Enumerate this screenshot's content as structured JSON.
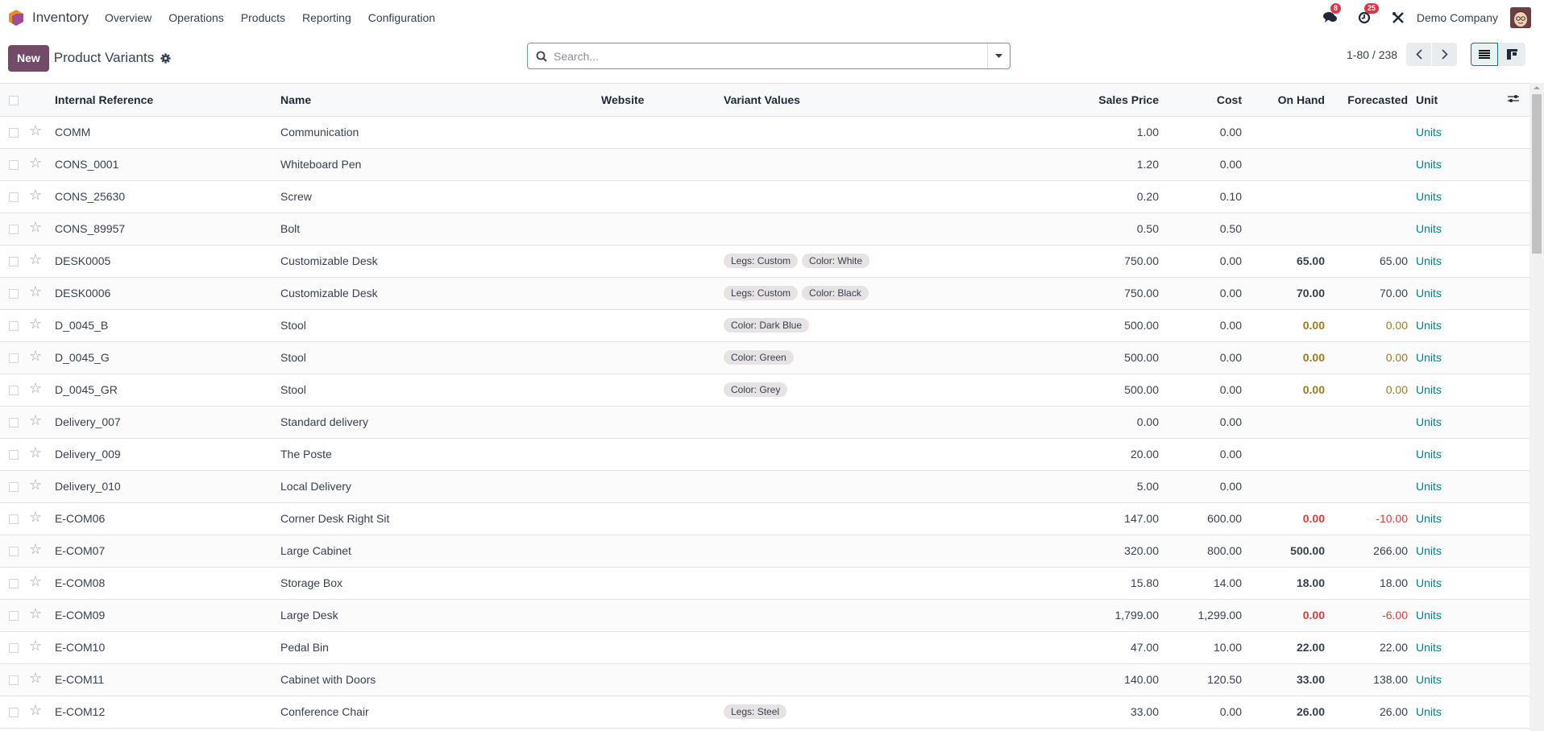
{
  "navbar": {
    "app_name": "Inventory",
    "menu": [
      "Overview",
      "Operations",
      "Products",
      "Reporting",
      "Configuration"
    ],
    "messages_badge": "8",
    "activities_badge": "25",
    "company": "Demo Company"
  },
  "control": {
    "new_label": "New",
    "title": "Product Variants",
    "search_placeholder": "Search...",
    "pager": "1-80 / 238"
  },
  "colors": {
    "brand": "#714B67",
    "link": "#017e84",
    "warning": "#9b7a21",
    "danger": "#d23f3a",
    "badge": "#dc3545"
  },
  "table": {
    "columns": {
      "ref": "Internal Reference",
      "name": "Name",
      "website": "Website",
      "variants": "Variant Values",
      "price": "Sales Price",
      "cost": "Cost",
      "onhand": "On Hand",
      "forecast": "Forecasted",
      "unit": "Unit"
    },
    "rows": [
      {
        "ref": "COMM",
        "name": "Communication",
        "variants": [],
        "price": "1.00",
        "cost": "0.00",
        "onhand": "",
        "forecast": "",
        "unit": "Units",
        "state": ""
      },
      {
        "ref": "CONS_0001",
        "name": "Whiteboard Pen",
        "variants": [],
        "price": "1.20",
        "cost": "0.00",
        "onhand": "",
        "forecast": "",
        "unit": "Units",
        "state": ""
      },
      {
        "ref": "CONS_25630",
        "name": "Screw",
        "variants": [],
        "price": "0.20",
        "cost": "0.10",
        "onhand": "",
        "forecast": "",
        "unit": "Units",
        "state": ""
      },
      {
        "ref": "CONS_89957",
        "name": "Bolt",
        "variants": [],
        "price": "0.50",
        "cost": "0.50",
        "onhand": "",
        "forecast": "",
        "unit": "Units",
        "state": ""
      },
      {
        "ref": "DESK0005",
        "name": "Customizable Desk",
        "variants": [
          "Legs: Custom",
          "Color: White"
        ],
        "price": "750.00",
        "cost": "0.00",
        "onhand": "65.00",
        "forecast": "65.00",
        "unit": "Units",
        "state": ""
      },
      {
        "ref": "DESK0006",
        "name": "Customizable Desk",
        "variants": [
          "Legs: Custom",
          "Color: Black"
        ],
        "price": "750.00",
        "cost": "0.00",
        "onhand": "70.00",
        "forecast": "70.00",
        "unit": "Units",
        "state": ""
      },
      {
        "ref": "D_0045_B",
        "name": "Stool",
        "variants": [
          "Color: Dark Blue"
        ],
        "price": "500.00",
        "cost": "0.00",
        "onhand": "0.00",
        "forecast": "0.00",
        "unit": "Units",
        "state": "warn"
      },
      {
        "ref": "D_0045_G",
        "name": "Stool",
        "variants": [
          "Color: Green"
        ],
        "price": "500.00",
        "cost": "0.00",
        "onhand": "0.00",
        "forecast": "0.00",
        "unit": "Units",
        "state": "warn"
      },
      {
        "ref": "D_0045_GR",
        "name": "Stool",
        "variants": [
          "Color: Grey"
        ],
        "price": "500.00",
        "cost": "0.00",
        "onhand": "0.00",
        "forecast": "0.00",
        "unit": "Units",
        "state": "warn"
      },
      {
        "ref": "Delivery_007",
        "name": "Standard delivery",
        "variants": [],
        "price": "0.00",
        "cost": "0.00",
        "onhand": "",
        "forecast": "",
        "unit": "Units",
        "state": ""
      },
      {
        "ref": "Delivery_009",
        "name": "The Poste",
        "variants": [],
        "price": "20.00",
        "cost": "0.00",
        "onhand": "",
        "forecast": "",
        "unit": "Units",
        "state": ""
      },
      {
        "ref": "Delivery_010",
        "name": "Local Delivery",
        "variants": [],
        "price": "5.00",
        "cost": "0.00",
        "onhand": "",
        "forecast": "",
        "unit": "Units",
        "state": ""
      },
      {
        "ref": "E-COM06",
        "name": "Corner Desk Right Sit",
        "variants": [],
        "price": "147.00",
        "cost": "600.00",
        "onhand": "0.00",
        "forecast": "-10.00",
        "unit": "Units",
        "state": "danger"
      },
      {
        "ref": "E-COM07",
        "name": "Large Cabinet",
        "variants": [],
        "price": "320.00",
        "cost": "800.00",
        "onhand": "500.00",
        "forecast": "266.00",
        "unit": "Units",
        "state": ""
      },
      {
        "ref": "E-COM08",
        "name": "Storage Box",
        "variants": [],
        "price": "15.80",
        "cost": "14.00",
        "onhand": "18.00",
        "forecast": "18.00",
        "unit": "Units",
        "state": ""
      },
      {
        "ref": "E-COM09",
        "name": "Large Desk",
        "variants": [],
        "price": "1,799.00",
        "cost": "1,299.00",
        "onhand": "0.00",
        "forecast": "-6.00",
        "unit": "Units",
        "state": "danger"
      },
      {
        "ref": "E-COM10",
        "name": "Pedal Bin",
        "variants": [],
        "price": "47.00",
        "cost": "10.00",
        "onhand": "22.00",
        "forecast": "22.00",
        "unit": "Units",
        "state": ""
      },
      {
        "ref": "E-COM11",
        "name": "Cabinet with Doors",
        "variants": [],
        "price": "140.00",
        "cost": "120.50",
        "onhand": "33.00",
        "forecast": "138.00",
        "unit": "Units",
        "state": ""
      },
      {
        "ref": "E-COM12",
        "name": "Conference Chair",
        "variants": [
          "Legs: Steel"
        ],
        "price": "33.00",
        "cost": "0.00",
        "onhand": "26.00",
        "forecast": "26.00",
        "unit": "Units",
        "state": ""
      }
    ]
  }
}
